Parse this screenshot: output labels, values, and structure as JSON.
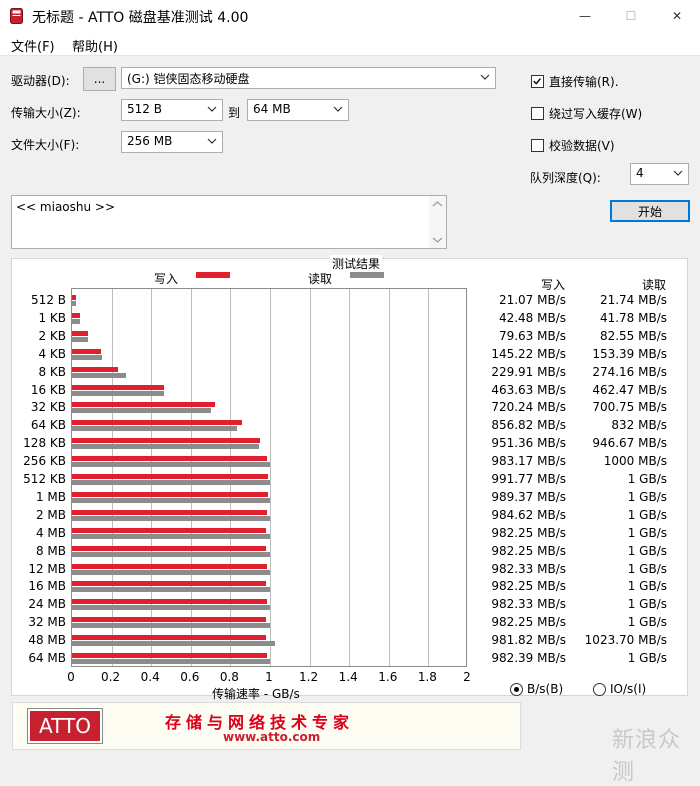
{
  "window": {
    "title": "无标题 - ATTO 磁盘基准测试 4.00",
    "minimize": "—",
    "maximize": "☐",
    "close": "✕"
  },
  "menu": [
    "文件(F)",
    "帮助(H)"
  ],
  "controls": {
    "drive_label": "驱动器(D):",
    "browse": "...",
    "drive_value": "(G:) 铠侠固态移动硬盘",
    "transfer_label": "传输大小(Z):",
    "transfer_from": "512 B",
    "to_label": "到",
    "transfer_to": "64 MB",
    "filesize_label": "文件大小(F):",
    "filesize_value": "256 MB",
    "direct_io": "直接传输(R).",
    "bypass_cache": "绕过写入缓存(W)",
    "verify": "校验数据(V)",
    "queue_label": "队列深度(Q):",
    "queue_value": "4",
    "start": "开始",
    "description": "<< miaoshu >>"
  },
  "checkbox_states": {
    "direct_io": true,
    "bypass_cache": false,
    "verify": false
  },
  "results": {
    "title": "测试结果",
    "write_legend": "写入",
    "read_legend": "读取",
    "write_head": "写入",
    "read_head": "读取",
    "x_title": "传输速率 - GB/s",
    "unit_bs": "B/s(B)",
    "unit_ios": "IO/s(I)",
    "unit_selected": "B/s"
  },
  "colors": {
    "write": "#e0202e",
    "read": "#8c8c8c"
  },
  "chart_data": {
    "type": "bar",
    "orientation": "horizontal",
    "xlim": [
      0,
      2
    ],
    "xticks": [
      "0",
      "0.2",
      "0.4",
      "0.6",
      "0.8",
      "1",
      "1.2",
      "1.4",
      "1.6",
      "1.8",
      "2"
    ],
    "categories": [
      "512 B",
      "1 KB",
      "2 KB",
      "4 KB",
      "8 KB",
      "16 KB",
      "32 KB",
      "64 KB",
      "128 KB",
      "256 KB",
      "512 KB",
      "1 MB",
      "2 MB",
      "4 MB",
      "8 MB",
      "12 MB",
      "16 MB",
      "24 MB",
      "32 MB",
      "48 MB",
      "64 MB"
    ],
    "series": [
      {
        "name": "写入",
        "values": [
          0.02107,
          0.04248,
          0.07963,
          0.14522,
          0.22991,
          0.46363,
          0.72024,
          0.85682,
          0.95136,
          0.98317,
          0.99177,
          0.98937,
          0.98462,
          0.98225,
          0.98225,
          0.98233,
          0.98225,
          0.98233,
          0.98225,
          0.98182,
          0.98239
        ]
      },
      {
        "name": "读取",
        "values": [
          0.02174,
          0.04178,
          0.08255,
          0.15339,
          0.27416,
          0.46247,
          0.70075,
          0.832,
          0.94667,
          1.0,
          1.0,
          1.0,
          1.0,
          1.0,
          1.0,
          1.0,
          1.0,
          1.0,
          1.0,
          1.0237,
          1.0
        ]
      }
    ],
    "write_text": [
      "21.07 MB/s",
      "42.48 MB/s",
      "79.63 MB/s",
      "145.22 MB/s",
      "229.91 MB/s",
      "463.63 MB/s",
      "720.24 MB/s",
      "856.82 MB/s",
      "951.36 MB/s",
      "983.17 MB/s",
      "991.77 MB/s",
      "989.37 MB/s",
      "984.62 MB/s",
      "982.25 MB/s",
      "982.25 MB/s",
      "982.33 MB/s",
      "982.25 MB/s",
      "982.33 MB/s",
      "982.25 MB/s",
      "981.82 MB/s",
      "982.39 MB/s"
    ],
    "read_text": [
      "21.74 MB/s",
      "41.78 MB/s",
      "82.55 MB/s",
      "153.39 MB/s",
      "274.16 MB/s",
      "462.47 MB/s",
      "700.75 MB/s",
      "832 MB/s",
      "946.67 MB/s",
      "1000 MB/s",
      "1 GB/s",
      "1 GB/s",
      "1 GB/s",
      "1 GB/s",
      "1 GB/s",
      "1 GB/s",
      "1 GB/s",
      "1 GB/s",
      "1 GB/s",
      "1023.70 MB/s",
      "1 GB/s"
    ]
  },
  "banner": {
    "logo": "ATTO",
    "slogan": "存储与网络技术专家",
    "url": "www.atto.com"
  },
  "watermark": "新浪众测"
}
